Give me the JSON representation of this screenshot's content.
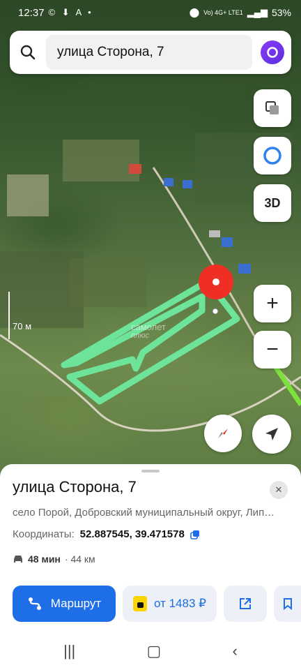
{
  "status_bar": {
    "time": "12:37",
    "notification_icons": "© ⬇ A •",
    "network": "Vo) 4G+ LTE1",
    "battery": "53%"
  },
  "search": {
    "query": "улица Сторона, 7"
  },
  "map_controls": {
    "layers_label": "",
    "alice_label": "",
    "three_d_label": "3D",
    "zoom_in_label": "+",
    "zoom_out_label": "−"
  },
  "map": {
    "scale_label": "70 м",
    "watermark_top": "самолет",
    "watermark_bottom": "плюс",
    "route_color": "#6ee39a",
    "pin_color": "#f02f24"
  },
  "place_card": {
    "title": "улица Сторона, 7",
    "address": "село Порой, Добровский муниципальный округ, Лип…",
    "coordinates_label": "Координаты:",
    "coordinates_value": "52.887545, 39.471578",
    "travel_time": "48 мин",
    "travel_distance": "· 44 км",
    "route_button": "Маршрут",
    "taxi_button": "от 1483 ₽"
  },
  "colors": {
    "accent": "#1e6fe7",
    "alice": "#8a3cf6",
    "taxi_yellow": "#fcd400"
  }
}
